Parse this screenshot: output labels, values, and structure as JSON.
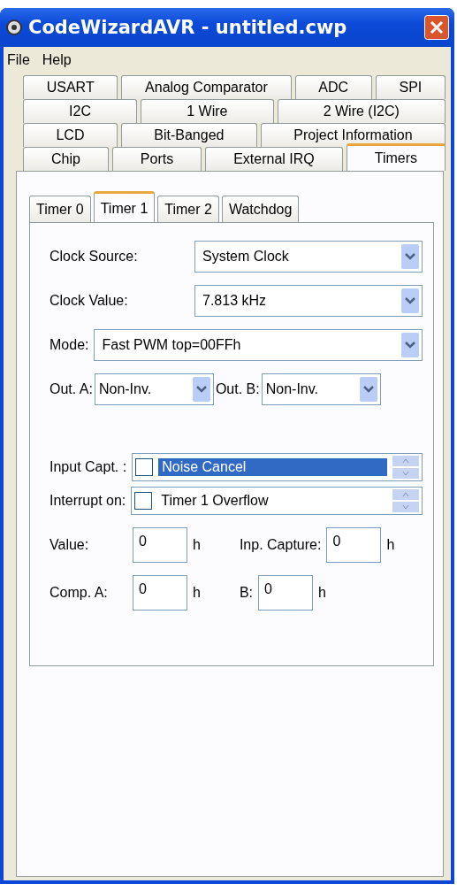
{
  "window": {
    "title": "CodeWizardAVR - untitled.cwp"
  },
  "menu": [
    {
      "label": "File"
    },
    {
      "label": "Help"
    }
  ],
  "tab_rows": [
    [
      {
        "label": "USART",
        "selected": false
      },
      {
        "label": "Analog Comparator",
        "selected": false
      },
      {
        "label": "ADC",
        "selected": false
      },
      {
        "label": "SPI",
        "selected": false
      }
    ],
    [
      {
        "label": "I2C",
        "selected": false
      },
      {
        "label": "1 Wire",
        "selected": false
      },
      {
        "label": "2 Wire (I2C)",
        "selected": false
      }
    ],
    [
      {
        "label": "LCD",
        "selected": false
      },
      {
        "label": "Bit-Banged",
        "selected": false
      },
      {
        "label": "Project Information",
        "selected": false
      }
    ],
    [
      {
        "label": "Chip",
        "selected": false
      },
      {
        "label": "Ports",
        "selected": false
      },
      {
        "label": "External IRQ",
        "selected": false
      },
      {
        "label": "Timers",
        "selected": true
      }
    ]
  ],
  "subtabs": [
    {
      "label": "Timer 0",
      "selected": false
    },
    {
      "label": "Timer 1",
      "selected": true
    },
    {
      "label": "Timer 2",
      "selected": false
    },
    {
      "label": "Watchdog",
      "selected": false
    }
  ],
  "dropdowns": [
    {
      "label": "Clock Source:",
      "value": "System Clock",
      "kind": "wide"
    },
    {
      "label": "Clock Value:",
      "value": "7.813 kHz",
      "kind": "wide"
    },
    {
      "label": "Mode:",
      "value": "Fast PWM top=00FFh",
      "kind": "long"
    }
  ],
  "outputs": [
    {
      "label": "Out. A:",
      "value": "Non-Inv."
    },
    {
      "label": "Out. B:",
      "value": "Non-Inv."
    }
  ],
  "check_lists": [
    {
      "label": "Input Capt. :",
      "option": "Noise Cancel",
      "checked": false,
      "selected": true
    },
    {
      "label": "Interrupt on:",
      "option": "Timer 1 Overflow",
      "checked": false,
      "selected": false
    }
  ],
  "number_rows": [
    [
      {
        "label": "Value:",
        "value": "0",
        "unit": "h"
      },
      {
        "label": "Inp. Capture:",
        "value": "0",
        "unit": "h"
      }
    ],
    [
      {
        "label": "Comp. A:",
        "value": "0",
        "unit": "h"
      },
      {
        "label": "B:",
        "value": "0",
        "unit": "h"
      }
    ]
  ]
}
